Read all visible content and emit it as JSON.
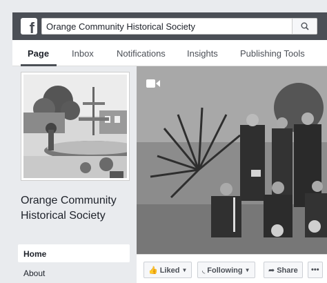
{
  "search": {
    "value": "Orange Community Historical Society"
  },
  "nav": {
    "tabs": [
      {
        "label": "Page"
      },
      {
        "label": "Inbox"
      },
      {
        "label": "Notifications"
      },
      {
        "label": "Insights"
      },
      {
        "label": "Publishing Tools"
      }
    ]
  },
  "page": {
    "name_line1": "Orange Community",
    "name_line2": "Historical Society"
  },
  "sidebar": {
    "items": [
      {
        "label": "Home"
      },
      {
        "label": "About"
      }
    ]
  },
  "actions": {
    "liked": "Liked",
    "following": "Following",
    "share": "Share",
    "more": "•••"
  },
  "colors": {
    "topbar": "#4b4f56",
    "background": "#e9ebee"
  }
}
